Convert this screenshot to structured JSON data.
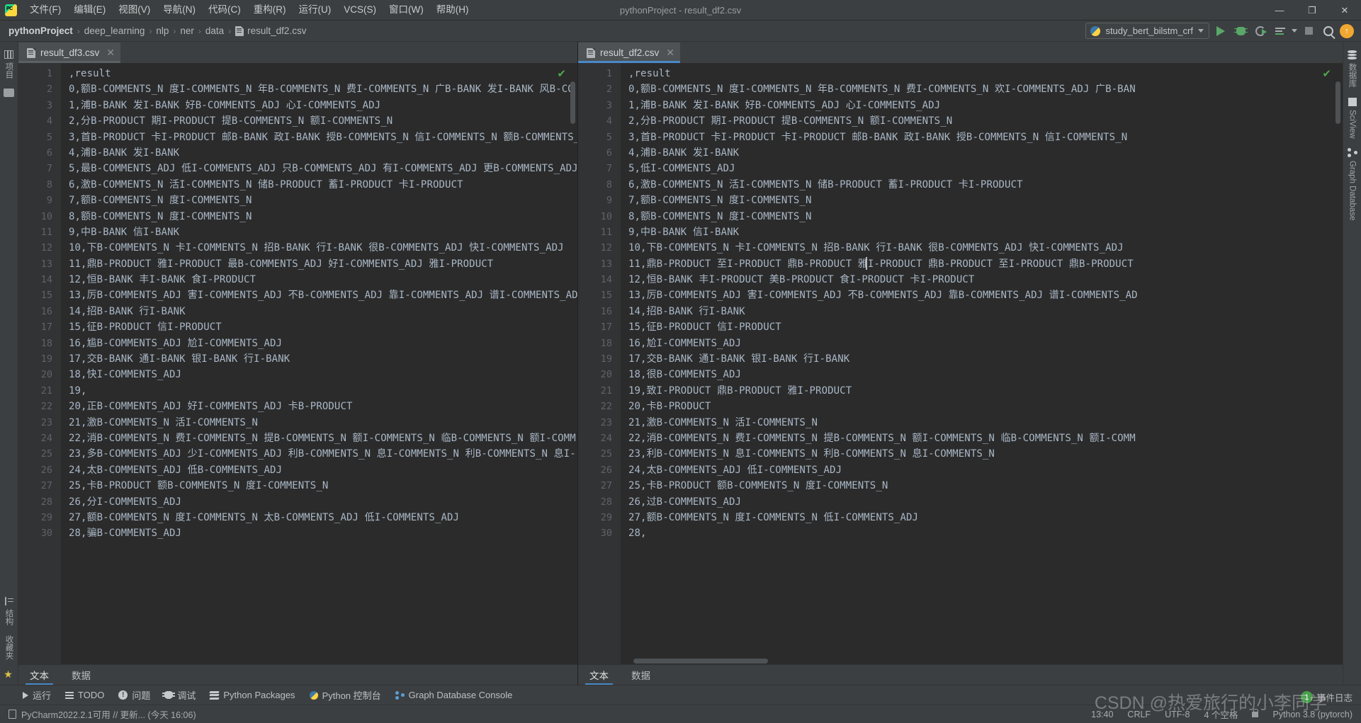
{
  "window": {
    "title": "pythonProject - result_df2.csv",
    "app_icon": "pycharm-logo-icon",
    "minimize": "—",
    "maximize": "❐",
    "close": "✕"
  },
  "menu": [
    {
      "label": "文件(F)"
    },
    {
      "label": "编辑(E)"
    },
    {
      "label": "视图(V)"
    },
    {
      "label": "导航(N)"
    },
    {
      "label": "代码(C)"
    },
    {
      "label": "重构(R)"
    },
    {
      "label": "运行(U)"
    },
    {
      "label": "VCS(S)"
    },
    {
      "label": "窗口(W)"
    },
    {
      "label": "帮助(H)"
    }
  ],
  "breadcrumb": {
    "items": [
      "pythonProject",
      "deep_learning",
      "nlp",
      "ner",
      "data"
    ],
    "file": "result_df2.csv",
    "separator": "›"
  },
  "toolbar": {
    "run_config": "study_bert_bilstm_crf",
    "run_label": "run-button",
    "debug_label": "debug-button",
    "coverage_label": "run-with-coverage-button",
    "profile_label": "profile-button",
    "stop_label": "stop-button",
    "search_label": "search-everywhere-button",
    "update_label": "update-button"
  },
  "left_strip": [
    {
      "label": "项目",
      "icon": "project-icon"
    },
    {
      "label": "",
      "icon": "folder-icon"
    }
  ],
  "left_strip_bottom": [
    {
      "label": "结构",
      "icon": "structure-icon"
    },
    {
      "label": "收藏夹",
      "icon": "favorites-icon"
    }
  ],
  "right_strip": [
    {
      "label": "数据库",
      "icon": "database-icon"
    },
    {
      "label": "SciView",
      "icon": "sciview-grid-icon"
    },
    {
      "label": "Graph Database",
      "icon": "graph-database-icon"
    }
  ],
  "editor_left": {
    "tab": {
      "label": "result_df3.csv",
      "close": "✕",
      "icon": "csv-file-icon",
      "active": false
    },
    "inspection_ok": "✔",
    "lines": [
      {
        "n": "1",
        "text": ",result"
      },
      {
        "n": "2",
        "text": "0,额B-COMMENTS_N 度I-COMMENTS_N 年B-COMMENTS_N 费I-COMMENTS_N 广B-BANK 发I-BANK 风B-CO"
      },
      {
        "n": "3",
        "text": "1,浦B-BANK 发I-BANK 好B-COMMENTS_ADJ 心I-COMMENTS_ADJ"
      },
      {
        "n": "4",
        "text": "2,分B-PRODUCT 期I-PRODUCT 提B-COMMENTS_N 额I-COMMENTS_N"
      },
      {
        "n": "5",
        "text": "3,首B-PRODUCT 卡I-PRODUCT 邮B-BANK 政I-BANK 授B-COMMENTS_N 信I-COMMENTS_N 额B-COMMENTS_"
      },
      {
        "n": "6",
        "text": "4,浦B-BANK 发I-BANK"
      },
      {
        "n": "7",
        "text": "5,最B-COMMENTS_ADJ 低I-COMMENTS_ADJ 只B-COMMENTS_ADJ 有I-COMMENTS_ADJ 更B-COMMENTS_ADJ"
      },
      {
        "n": "8",
        "text": "6,激B-COMMENTS_N 活I-COMMENTS_N 储B-PRODUCT 蓄I-PRODUCT 卡I-PRODUCT"
      },
      {
        "n": "9",
        "text": "7,额B-COMMENTS_N 度I-COMMENTS_N"
      },
      {
        "n": "10",
        "text": "8,额B-COMMENTS_N 度I-COMMENTS_N"
      },
      {
        "n": "11",
        "text": "9,中B-BANK 信I-BANK"
      },
      {
        "n": "12",
        "text": "10,下B-COMMENTS_N 卡I-COMMENTS_N 招B-BANK 行I-BANK 很B-COMMENTS_ADJ 快I-COMMENTS_ADJ"
      },
      {
        "n": "13",
        "text": "11,鼎B-PRODUCT 雅I-PRODUCT 最B-COMMENTS_ADJ 好I-COMMENTS_ADJ 雅I-PRODUCT"
      },
      {
        "n": "14",
        "text": "12,恒B-BANK 丰I-BANK 食I-PRODUCT"
      },
      {
        "n": "15",
        "text": "13,厉B-COMMENTS_ADJ 害I-COMMENTS_ADJ 不B-COMMENTS_ADJ 靠I-COMMENTS_ADJ 谱I-COMMENTS_AD"
      },
      {
        "n": "16",
        "text": "14,招B-BANK 行I-BANK"
      },
      {
        "n": "17",
        "text": "15,征B-PRODUCT 信I-PRODUCT"
      },
      {
        "n": "18",
        "text": "16,尴B-COMMENTS_ADJ 尬I-COMMENTS_ADJ"
      },
      {
        "n": "19",
        "text": "17,交B-BANK 通I-BANK 银I-BANK 行I-BANK"
      },
      {
        "n": "20",
        "text": "18,快I-COMMENTS_ADJ"
      },
      {
        "n": "21",
        "text": "19,"
      },
      {
        "n": "22",
        "text": "20,正B-COMMENTS_ADJ 好I-COMMENTS_ADJ 卡B-PRODUCT"
      },
      {
        "n": "23",
        "text": "21,激B-COMMENTS_N 活I-COMMENTS_N"
      },
      {
        "n": "24",
        "text": "22,消B-COMMENTS_N 费I-COMMENTS_N 提B-COMMENTS_N 额I-COMMENTS_N 临B-COMMENTS_N 额I-COMM"
      },
      {
        "n": "25",
        "text": "23,多B-COMMENTS_ADJ 少I-COMMENTS_ADJ 利B-COMMENTS_N 息I-COMMENTS_N 利B-COMMENTS_N 息I-"
      },
      {
        "n": "26",
        "text": "24,太B-COMMENTS_ADJ 低B-COMMENTS_ADJ"
      },
      {
        "n": "27",
        "text": "25,卡B-PRODUCT 额B-COMMENTS_N 度I-COMMENTS_N"
      },
      {
        "n": "28",
        "text": "26,分I-COMMENTS_ADJ"
      },
      {
        "n": "29",
        "text": "27,额B-COMMENTS_N 度I-COMMENTS_N 太B-COMMENTS_ADJ 低I-COMMENTS_ADJ"
      },
      {
        "n": "30",
        "text": "28,骗B-COMMENTS_ADJ"
      }
    ],
    "sub_tabs": [
      {
        "label": "文本",
        "active": true
      },
      {
        "label": "数据",
        "active": false
      }
    ]
  },
  "editor_right": {
    "tab": {
      "label": "result_df2.csv",
      "close": "✕",
      "icon": "csv-file-icon",
      "active": true
    },
    "inspection_ok": "✔",
    "lines": [
      {
        "n": "1",
        "text": ",result"
      },
      {
        "n": "2",
        "text": "0,额B-COMMENTS_N 度I-COMMENTS_N 年B-COMMENTS_N 费I-COMMENTS_N 欢I-COMMENTS_ADJ 广B-BAN"
      },
      {
        "n": "3",
        "text": "1,浦B-BANK 发I-BANK 好B-COMMENTS_ADJ 心I-COMMENTS_ADJ"
      },
      {
        "n": "4",
        "text": "2,分B-PRODUCT 期I-PRODUCT 提B-COMMENTS_N 额I-COMMENTS_N"
      },
      {
        "n": "5",
        "text": "3,首B-PRODUCT 卡I-PRODUCT 卡I-PRODUCT 邮B-BANK 政I-BANK 授B-COMMENTS_N 信I-COMMENTS_N"
      },
      {
        "n": "6",
        "text": "4,浦B-BANK 发I-BANK"
      },
      {
        "n": "7",
        "text": "5,低I-COMMENTS_ADJ"
      },
      {
        "n": "8",
        "text": "6,激B-COMMENTS_N 活I-COMMENTS_N 储B-PRODUCT 蓄I-PRODUCT 卡I-PRODUCT"
      },
      {
        "n": "9",
        "text": "7,额B-COMMENTS_N 度I-COMMENTS_N"
      },
      {
        "n": "10",
        "text": "8,额B-COMMENTS_N 度I-COMMENTS_N"
      },
      {
        "n": "11",
        "text": "9,中B-BANK 信I-BANK"
      },
      {
        "n": "12",
        "text": "10,下B-COMMENTS_N 卡I-COMMENTS_N 招B-BANK 行I-BANK 很B-COMMENTS_ADJ 快I-COMMENTS_ADJ"
      },
      {
        "n": "13",
        "text": "11,鼎B-PRODUCT 至I-PRODUCT 鼎B-PRODUCT 雅I-PRODUCT 鼎B-PRODUCT 至I-PRODUCT 鼎B-PRODUCT"
      },
      {
        "n": "14",
        "text": "12,恒B-BANK 丰I-PRODUCT 美B-PRODUCT 食I-PRODUCT 卡I-PRODUCT"
      },
      {
        "n": "15",
        "text": "13,厉B-COMMENTS_ADJ 害I-COMMENTS_ADJ 不B-COMMENTS_ADJ 靠B-COMMENTS_ADJ 谱I-COMMENTS_AD"
      },
      {
        "n": "16",
        "text": "14,招B-BANK 行I-BANK"
      },
      {
        "n": "17",
        "text": "15,征B-PRODUCT 信I-PRODUCT"
      },
      {
        "n": "18",
        "text": "16,尬I-COMMENTS_ADJ"
      },
      {
        "n": "19",
        "text": "17,交B-BANK 通I-BANK 银I-BANK 行I-BANK"
      },
      {
        "n": "20",
        "text": "18,很B-COMMENTS_ADJ"
      },
      {
        "n": "21",
        "text": "19,致I-PRODUCT 鼎B-PRODUCT 雅I-PRODUCT"
      },
      {
        "n": "22",
        "text": "20,卡B-PRODUCT"
      },
      {
        "n": "23",
        "text": "21,激B-COMMENTS_N 活I-COMMENTS_N"
      },
      {
        "n": "24",
        "text": "22,消B-COMMENTS_N 费I-COMMENTS_N 提B-COMMENTS_N 额I-COMMENTS_N 临B-COMMENTS_N 额I-COMM"
      },
      {
        "n": "25",
        "text": "23,利B-COMMENTS_N 息I-COMMENTS_N 利B-COMMENTS_N 息I-COMMENTS_N"
      },
      {
        "n": "26",
        "text": "24,太B-COMMENTS_ADJ 低I-COMMENTS_ADJ"
      },
      {
        "n": "27",
        "text": "25,卡B-PRODUCT 额B-COMMENTS_N 度I-COMMENTS_N"
      },
      {
        "n": "28",
        "text": "26,过B-COMMENTS_ADJ"
      },
      {
        "n": "29",
        "text": "27,额B-COMMENTS_N 度I-COMMENTS_N 低I-COMMENTS_ADJ"
      },
      {
        "n": "30",
        "text": "28,"
      }
    ],
    "sub_tabs": [
      {
        "label": "文本",
        "active": true
      },
      {
        "label": "数据",
        "active": false
      }
    ]
  },
  "tool_windows": [
    {
      "label": "运行",
      "icon": "run-icon"
    },
    {
      "label": "TODO",
      "icon": "todo-icon"
    },
    {
      "label": "问题",
      "icon": "problems-icon"
    },
    {
      "label": "调试",
      "icon": "debug-icon"
    },
    {
      "label": "Python Packages",
      "icon": "packages-icon"
    },
    {
      "label": "Python 控制台",
      "icon": "python-console-icon"
    },
    {
      "label": "Graph Database Console",
      "icon": "graph-database-console-icon"
    }
  ],
  "status_bar": {
    "message": "PyCharm2022.2.1可用 // 更新... (今天 16:06)",
    "position": "13:40",
    "line_separator": "CRLF",
    "encoding": "UTF-8",
    "indent": "4 个空格",
    "interpreter": "Python 3.8 (pytorch)",
    "event_log": "事件日志",
    "event_log_count": "1"
  },
  "watermark": "CSDN @热爱旅行的小李同学",
  "colors": {
    "accent_blue": "#4a88c7",
    "ok_green": "#4ea84e",
    "editor_bg": "#2b2b2b",
    "chrome_bg": "#3c3f41",
    "text": "#a9b7c6"
  }
}
